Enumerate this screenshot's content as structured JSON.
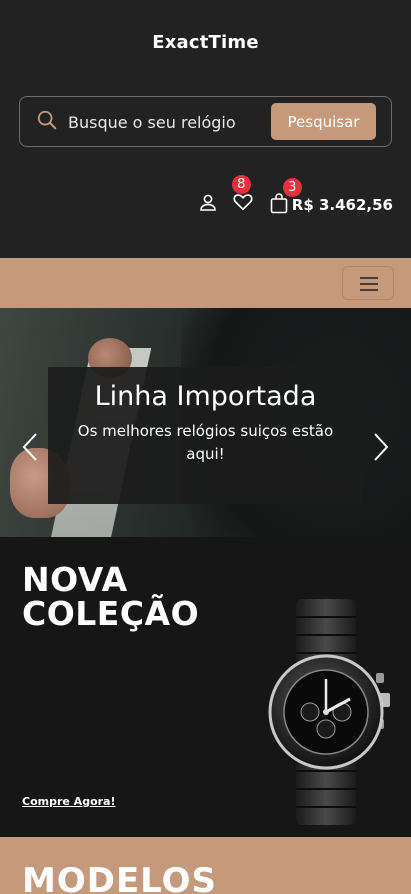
{
  "header": {
    "brand": "ExactTime",
    "search": {
      "placeholder": "Busque o seu relógio",
      "button_label": "Pesquisar"
    },
    "favorites_count": "8",
    "cart_count": "3",
    "cart_total": "R$ 3.462,56"
  },
  "hero": {
    "title": "Linha Importada",
    "text": "Os melhores relógios suiços estão aqui!"
  },
  "promo": {
    "title_line1": "NOVA",
    "title_line2": "COLEÇÃO",
    "link_label": "Compre Agora!"
  },
  "models": {
    "title": "MODELOS"
  },
  "colors": {
    "accent": "#c59a7c",
    "dark": "#222222",
    "badge": "#e5303d"
  }
}
